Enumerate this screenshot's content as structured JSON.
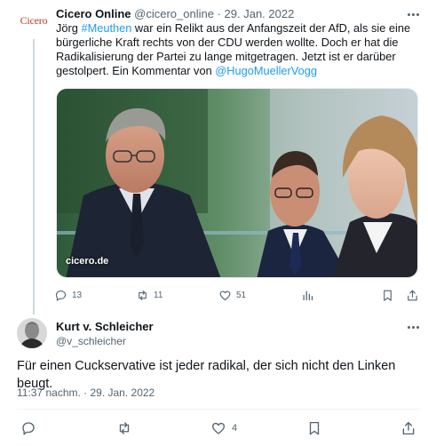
{
  "parent_tweet": {
    "avatar_text": "Cicero",
    "name": "Cicero Online",
    "handle": "@cicero_online",
    "separator": " · ",
    "date": "29. Jan. 2022",
    "text_1": "Jörg ",
    "hashtag": "#Meuthen",
    "text_2": " war ein Relikt aus der Anfangszeit der AfD, als sie eine bürgerliche Kraft rechts von der CDU werden wollte. Doch er hat die Radikalisierung der Partei zu lange mitgetragen. Jetzt ist er darüber gestolpert. Ein Kommentar von ",
    "mention": "@HugoMuellerVogg",
    "media_label": "cicero.de",
    "replies": "13",
    "retweets": "11",
    "likes": "51"
  },
  "main_tweet": {
    "name": "Kurt v. Schleicher",
    "handle": "@v_schleicher",
    "text": "Für einen Cuckservative ist jeder radikal, der sich nicht den Linken beugt.",
    "timestamp": "11:37 nachm. · 29. Jan. 2022",
    "likes": "4"
  },
  "icons": [
    "reply-icon",
    "retweet-icon",
    "like-icon",
    "views-icon",
    "bookmark-icon",
    "share-icon",
    "more-icon"
  ],
  "colors": {
    "link": "#1d9bf0",
    "secondary": "#536471",
    "text": "#0f1419",
    "thread_line": "#cfd9de"
  }
}
